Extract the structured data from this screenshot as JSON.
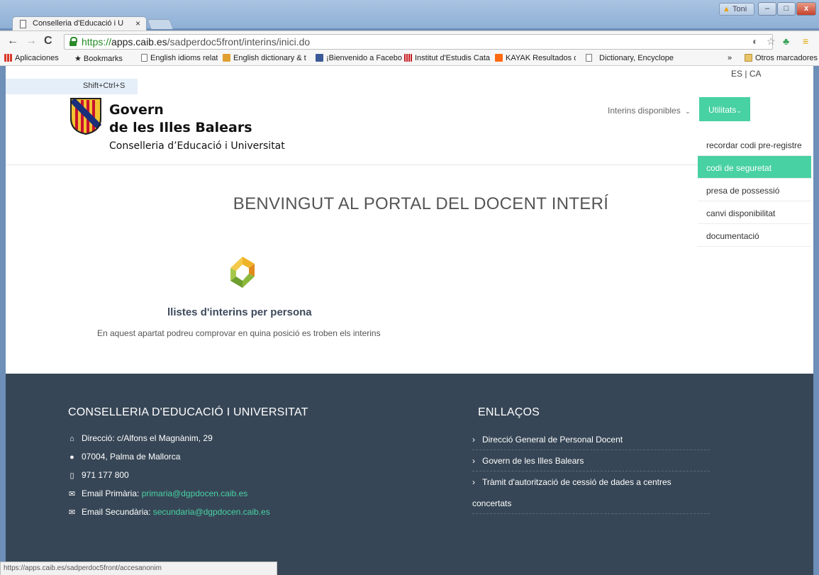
{
  "browser": {
    "tab_title": "Conselleria d'Educació i U",
    "tab_close": "×",
    "user_badge": "Toni",
    "window_buttons": {
      "minimize": "–",
      "maximize": "□",
      "close": "x"
    },
    "url_scheme": "https://",
    "url_host": "apps.caib.es",
    "url_path": "/sadperdoc5front/interins/inici.do",
    "bookmarks": [
      {
        "label": "Aplicaciones",
        "icon": "apps-grid-icon",
        "color": "#d9382a"
      },
      {
        "label": "Bookmarks",
        "icon": "star-icon",
        "color": "#444444"
      },
      {
        "label": "English idioms relatin",
        "icon": "page-icon",
        "color": "#666666"
      },
      {
        "label": "English dictionary & t",
        "icon": "crest-icon",
        "color": "#e0a030"
      },
      {
        "label": "¡Bienvenido a Facebo",
        "icon": "facebook-icon",
        "color": "#3b5998"
      },
      {
        "label": "Institut d'Estudis Cata",
        "icon": "iec-icon",
        "color": "#c4161c"
      },
      {
        "label": "KAYAK Resultados de",
        "icon": "kayak-icon",
        "color": "#ff690f"
      },
      {
        "label": "Dictionary, Encyclope",
        "icon": "dictionary-icon",
        "color": "#666666"
      }
    ],
    "bookmarks_more": "»",
    "other_bookmarks": "Otros marcadores",
    "status_url": "https://apps.caib.es/sadperdoc5front/accesanonim"
  },
  "page": {
    "lang": {
      "es": "ES",
      "sep": " | ",
      "ca": "CA"
    },
    "shortcut_hint": "Shift+Ctrl+S",
    "logo": {
      "line1": "Govern",
      "line2": "de les Illes Balears",
      "line3": "Conselleria d’Educació i Universitat"
    },
    "nav": {
      "interins": "Interins disponibles",
      "utilitats": "Utilitats"
    },
    "dropdown": [
      "recordar codi pre-registre",
      "codi de seguretat",
      "presa de possessió",
      "canvi disponibilitat",
      "documentació"
    ],
    "welcome": "BENVINGUT AL PORTAL DEL DOCENT INTERÍ",
    "llistes_title": "llistes d'interins per persona",
    "llistes_desc": "En aquest apartat podreu comprovar en quina posició es troben els interins"
  },
  "footer": {
    "left_title": "CONSELLERIA D'EDUCACIÓ I UNIVERSITAT",
    "address": "Direcció: c/Alfons el Magnànim, 29",
    "city": "07004, Palma de Mallorca",
    "phone": "971 177 800",
    "email_primaria_label": "Email Primària:",
    "email_primaria": "primaria@dgpdocen.caib.es",
    "email_secundaria_label": "Email Secundària:",
    "email_secundaria": "secundaria@dgpdocen.caib.es",
    "right_title": "ENLLAÇOS",
    "links": [
      "Direcció General de Personal Docent",
      "Govern de les Illes Balears",
      "Tràmit d'autorització de cessió de dades a centres"
    ],
    "link_wrap": "concertats"
  },
  "colors": {
    "accent": "#48d1a3",
    "footer_bg": "#374656"
  }
}
